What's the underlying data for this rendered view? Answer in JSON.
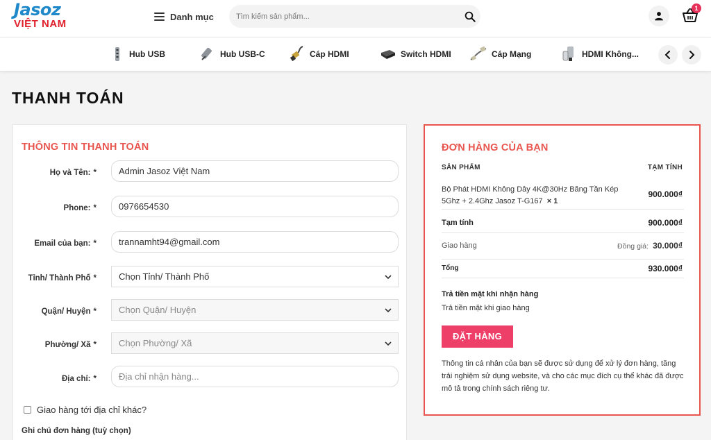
{
  "header": {
    "logo_top": "Jasoz",
    "logo_bottom": "VIỆT NAM",
    "menu_label": "Danh mục",
    "search_placeholder": "Tìm kiếm sản phẩm...",
    "cart_count": "1"
  },
  "categories": [
    {
      "label": "Hub USB",
      "icon": "usb-hub-icon"
    },
    {
      "label": "Hub USB-C",
      "icon": "usb-c-hub-icon"
    },
    {
      "label": "Cáp HDMI",
      "icon": "hdmi-cable-icon"
    },
    {
      "label": "Switch HDMI",
      "icon": "hdmi-switch-icon"
    },
    {
      "label": "Cáp Mạng",
      "icon": "network-cable-icon"
    },
    {
      "label": "HDMI Không...",
      "icon": "wireless-hdmi-icon"
    }
  ],
  "page": {
    "title": "THANH TOÁN"
  },
  "billing": {
    "heading": "THÔNG TIN THANH TOÁN",
    "required_mark": "*",
    "fields": {
      "name": {
        "label": "Họ và Tên:",
        "value": "Admin Jasoz Việt Nam"
      },
      "phone": {
        "label": "Phone:",
        "value": "0976654530"
      },
      "email": {
        "label": "Email của bạn:",
        "value": "trannamht94@gmail.com"
      },
      "city": {
        "label": "Tỉnh/ Thành Phố",
        "value": "Chọn Tỉnh/ Thành Phố"
      },
      "district": {
        "label": "Quận/ Huyện",
        "value": "Chọn Quận/ Huyện"
      },
      "ward": {
        "label": "Phường/ Xã",
        "value": "Chọn Phường/ Xã"
      },
      "address": {
        "label": "Địa chỉ:",
        "placeholder": "Địa chỉ nhận hàng..."
      }
    },
    "ship_other": "Giao hàng tới địa chỉ khác?",
    "notes_label": "Ghi chú đơn hàng (tuỳ chọn)"
  },
  "order": {
    "heading": "ĐƠN HÀNG CỦA BẠN",
    "col_product": "SẢN PHẨM",
    "col_subtotal": "TẠM TÍNH",
    "item_name_line1": "Bộ Phát HDMI Không Dây 4K@30Hz Băng Tần Kép",
    "item_name_line2": "5Ghz + 2.4Ghz Jasoz T-G167",
    "item_qty": "× 1",
    "item_price": "900.000₫",
    "subtotal_label": "Tạm tính",
    "subtotal_value": "900.000₫",
    "shipping_label": "Giao hàng",
    "shipping_prefix": "Đồng giá:",
    "shipping_value": "30.000₫",
    "total_label": "Tổng",
    "total_value": "930.000₫",
    "payment_title": "Trả tiền mặt khi nhận hàng",
    "payment_desc": "Trả tiền mặt khi giao hàng",
    "place_order": "ĐẶT HÀNG",
    "privacy": "Thông tin cá nhân của bạn sẽ được sử dụng để xử lý đơn hàng, tăng trải nghiệm sử dụng website, và cho các mục đích cụ thể khác đã được mô tả trong chính sách riêng tư."
  },
  "colors": {
    "accent": "#e8554e",
    "button": "#ee3f69",
    "logo_blue": "#1e88c9",
    "logo_red": "#e0212b"
  }
}
